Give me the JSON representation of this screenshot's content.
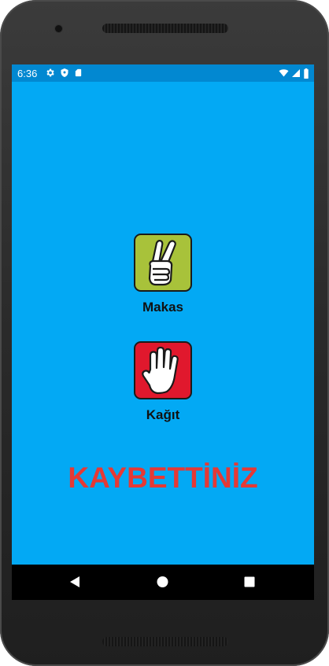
{
  "status_bar": {
    "time": "6:36"
  },
  "choices": [
    {
      "label": "Makas",
      "icon": "scissors-hand-icon",
      "tile_color": "#a8c23a"
    },
    {
      "label": "Kağıt",
      "icon": "paper-hand-icon",
      "tile_color": "#e0182d"
    }
  ],
  "result": {
    "text": "KAYBETTİNİZ",
    "color": "#e53935"
  },
  "navigation": {
    "back": "back-icon",
    "home": "home-icon",
    "recents": "recents-icon"
  }
}
